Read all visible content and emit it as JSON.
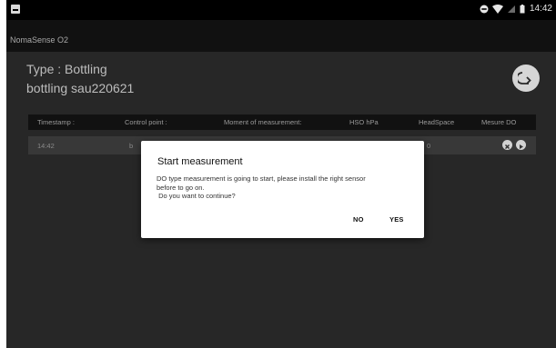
{
  "status_bar": {
    "time": "14:42"
  },
  "app_bar": {
    "title": "NomaSense O2"
  },
  "info": {
    "type_line": "Type : Bottling",
    "batch_line": "bottling sau220621"
  },
  "table": {
    "headers": [
      "Timestamp :",
      "Control point :",
      "Moment of measurement:",
      "HSO hPa",
      "HeadSpace",
      "Mesure DO"
    ],
    "rows": [
      {
        "timestamp": "14:42",
        "control_point": "b",
        "headspace": "0"
      }
    ]
  },
  "dialog": {
    "title": "Start measurement",
    "message_line1": "DO type measurement is going to start, please install the right sensor",
    "message_line2": "before to go on.",
    "message_line3": " Do you want to continue?",
    "no_label": "NO",
    "yes_label": "YES"
  }
}
